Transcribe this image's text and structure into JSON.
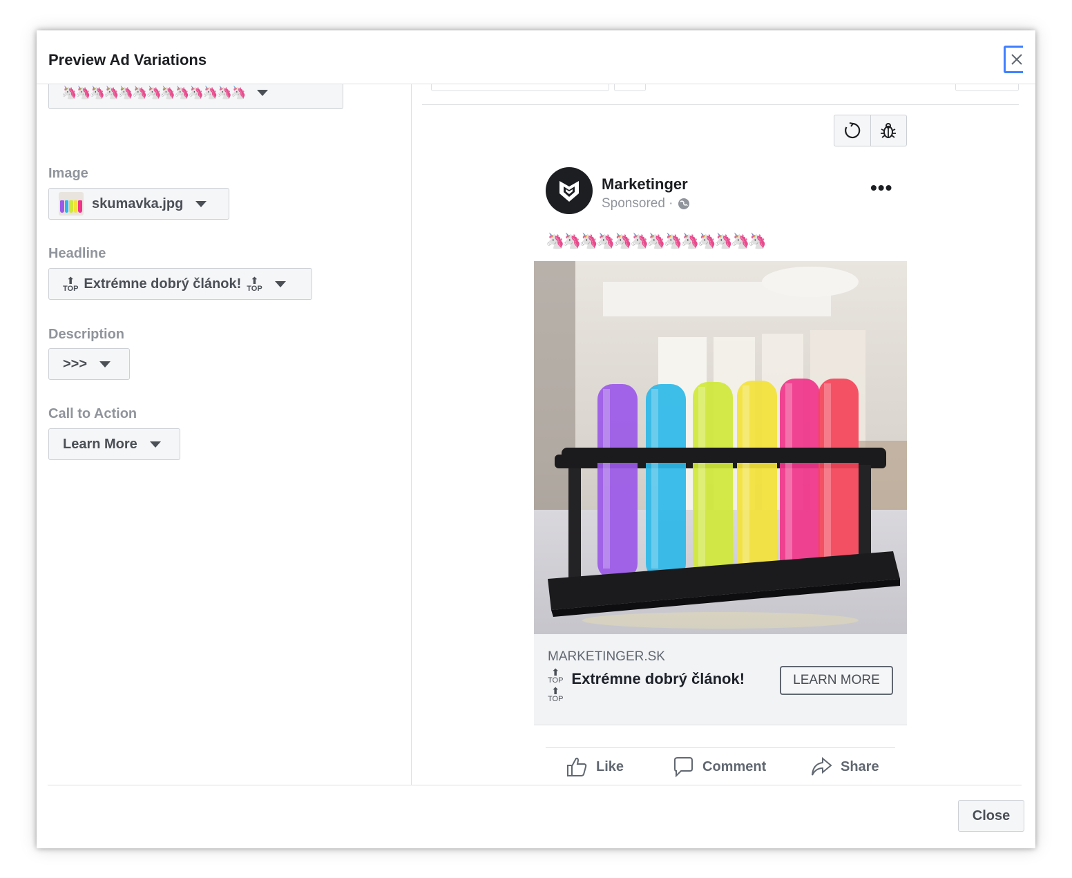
{
  "modal": {
    "title": "Preview Ad Variations"
  },
  "left": {
    "primary_text_value": "🦄🦄🦄🦄🦄🦄🦄🦄🦄🦄🦄🦄🦄",
    "image_label": "Image",
    "image_value": "skumavka.jpg",
    "headline_label": "Headline",
    "headline_value": "Extrémne dobrý článok!",
    "description_label": "Description",
    "description_value": ">>>",
    "cta_label": "Call to Action",
    "cta_value": "Learn More"
  },
  "post": {
    "page_name": "Marketinger",
    "sponsored": "Sponsored ·",
    "primary_text": "🦄🦄🦄🦄🦄🦄🦄🦄🦄🦄🦄🦄🦄",
    "domain": "MARKETINGER.SK",
    "headline": "Extrémne dobrý článok!",
    "top_label": "TOP",
    "cta_button": "LEARN MORE",
    "actions": {
      "like": "Like",
      "comment": "Comment",
      "share": "Share"
    }
  },
  "footer": {
    "close_label": "Close"
  },
  "colors": {
    "tube_purple": "#9b59e8",
    "tube_cyan": "#2cb8e8",
    "tube_lime": "#cfe83a",
    "tube_yellow": "#f3e23a",
    "tube_pink": "#f0348a",
    "tube_red": "#f5445a",
    "focus_blue": "#4080ff"
  }
}
